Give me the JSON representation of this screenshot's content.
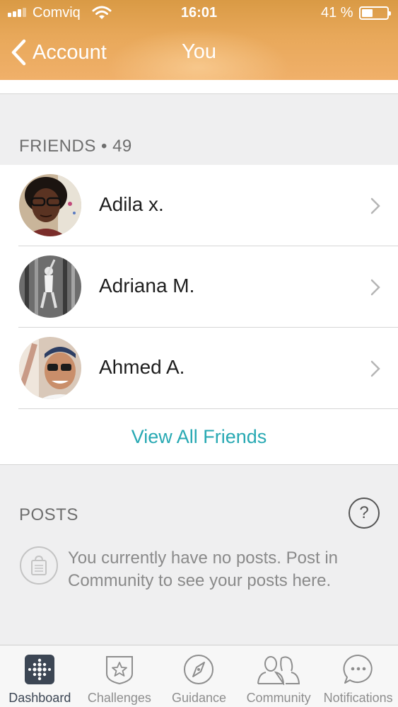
{
  "status_bar": {
    "carrier": "Comviq",
    "time": "16:01",
    "battery": "41 %"
  },
  "nav": {
    "back_label": "Account",
    "title": "You"
  },
  "friends": {
    "title": "FRIENDS • 49",
    "items": [
      {
        "name": "Adila x."
      },
      {
        "name": "Adriana M."
      },
      {
        "name": "Ahmed A."
      }
    ],
    "view_all": "View All Friends"
  },
  "posts": {
    "title": "POSTS",
    "help": "?",
    "empty_text": "You currently have no posts. Post in Community to see your posts here."
  },
  "tabs": [
    {
      "label": "Dashboard",
      "icon": "dashboard-icon",
      "active": true
    },
    {
      "label": "Challenges",
      "icon": "challenges-star-icon"
    },
    {
      "label": "Guidance",
      "icon": "compass-icon"
    },
    {
      "label": "Community",
      "icon": "community-people-icon"
    },
    {
      "label": "Notifications",
      "icon": "chat-bubble-icon"
    }
  ],
  "colors": {
    "header": "#e8a85a",
    "link": "#28a9b3",
    "active_tab": "#3c4654"
  }
}
